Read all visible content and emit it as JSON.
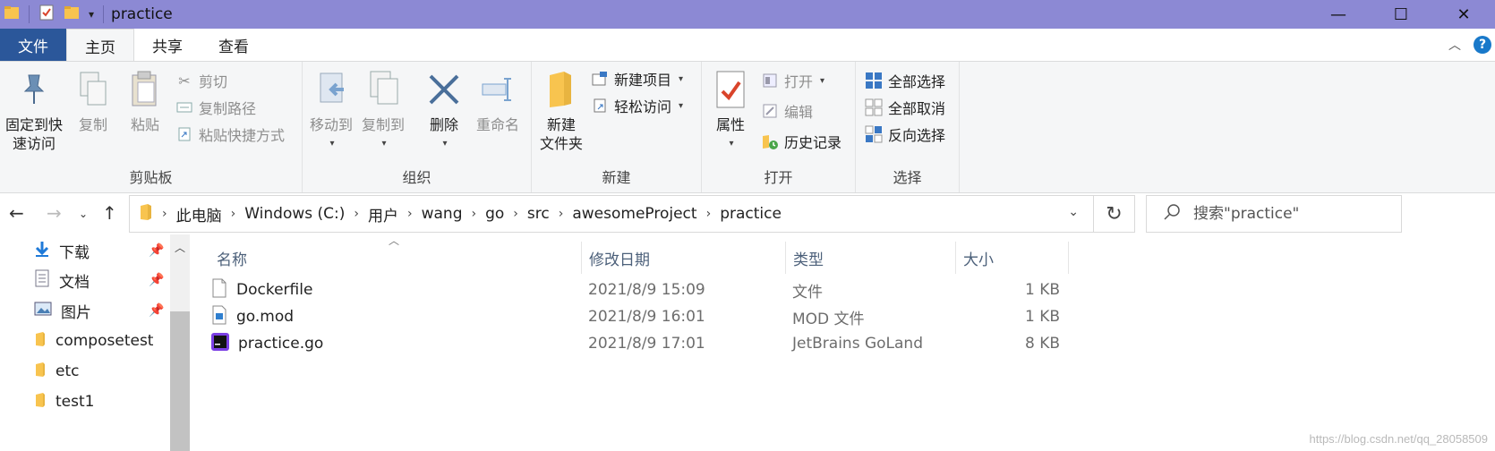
{
  "window": {
    "title": "practice"
  },
  "ribbon_tabs": {
    "file": "文件",
    "home": "主页",
    "share": "共享",
    "view": "查看"
  },
  "clipboard": {
    "label": "剪贴板",
    "pin_line1": "固定到快",
    "pin_line2": "速访问",
    "copy": "复制",
    "paste": "粘贴",
    "cut": "剪切",
    "copy_path": "复制路径",
    "paste_shortcut": "粘贴快捷方式"
  },
  "organize": {
    "label": "组织",
    "move_to": "移动到",
    "copy_to": "复制到",
    "delete": "删除",
    "rename": "重命名"
  },
  "new": {
    "label": "新建",
    "new_folder_line1": "新建",
    "new_folder_line2": "文件夹",
    "new_item": "新建项目",
    "easy_access": "轻松访问"
  },
  "open": {
    "label": "打开",
    "properties": "属性",
    "open": "打开",
    "edit": "编辑",
    "history": "历史记录"
  },
  "select": {
    "label": "选择",
    "select_all": "全部选择",
    "select_none": "全部取消",
    "invert": "反向选择"
  },
  "address": {
    "crumbs": [
      "此电脑",
      "Windows (C:)",
      "用户",
      "wang",
      "go",
      "src",
      "awesomeProject",
      "practice"
    ]
  },
  "search": {
    "placeholder": "搜索\"practice\""
  },
  "nav_pane": {
    "items": [
      {
        "label": "下载",
        "icon": "download-arrow-icon",
        "pinned": true
      },
      {
        "label": "文档",
        "icon": "document-icon",
        "pinned": true
      },
      {
        "label": "图片",
        "icon": "picture-icon",
        "pinned": true
      },
      {
        "label": "composetest",
        "icon": "folder-icon",
        "pinned": false
      },
      {
        "label": "etc",
        "icon": "folder-icon",
        "pinned": false
      },
      {
        "label": "test1",
        "icon": "folder-icon",
        "pinned": false
      }
    ]
  },
  "columns": {
    "name": "名称",
    "modified": "修改日期",
    "type": "类型",
    "size": "大小"
  },
  "files": [
    {
      "name": "Dockerfile",
      "modified": "2021/8/9 15:09",
      "type": "文件",
      "size": "1 KB",
      "icon": "blank-file-icon"
    },
    {
      "name": "go.mod",
      "modified": "2021/8/9 16:01",
      "type": "MOD 文件",
      "size": "1 KB",
      "icon": "mod-file-icon"
    },
    {
      "name": "practice.go",
      "modified": "2021/8/9 17:01",
      "type": "JetBrains GoLand",
      "size": "8 KB",
      "icon": "goland-file-icon"
    }
  ],
  "watermark": "https://blog.csdn.net/qq_28058509",
  "colors": {
    "titlebar": "#8c89d4",
    "file_tab": "#2b579a",
    "ribbon_bg": "#f5f6f7",
    "folder": "#f8c44f"
  }
}
